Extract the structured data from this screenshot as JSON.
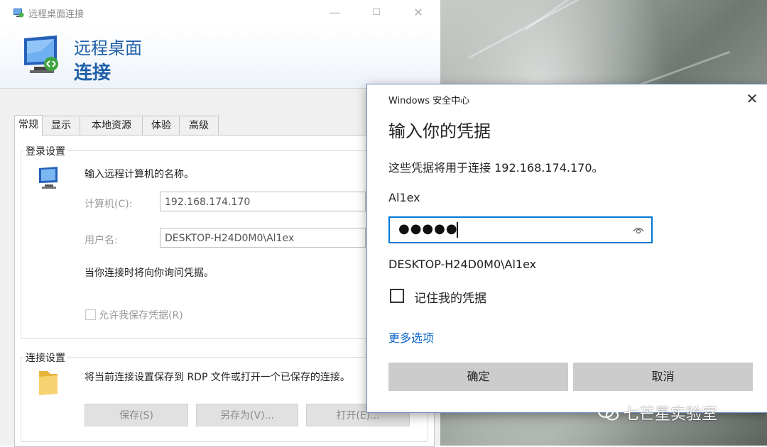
{
  "rdp": {
    "window_title": "远程桌面连接",
    "header_line1": "远程桌面",
    "header_line2": "连接",
    "minimize": "—",
    "maximize": "☐",
    "close": "✕",
    "tabs": [
      {
        "label": "常规",
        "active": true
      },
      {
        "label": "显示",
        "active": false
      },
      {
        "label": "本地资源",
        "active": false
      },
      {
        "label": "体验",
        "active": false
      },
      {
        "label": "高级",
        "active": false
      }
    ],
    "login": {
      "group_title": "登录设置",
      "instruction": "输入远程计算机的名称。",
      "computer_label": "计算机(C):",
      "computer_value": "192.168.174.170",
      "username_label": "用户名:",
      "username_value": "DESKTOP-H24D0M0\\Al1ex",
      "prompt_note": "当你连接时将向你询问凭据。",
      "allow_save_label": "允许我保存凭据(R)"
    },
    "connection": {
      "group_title": "连接设置",
      "description": "将当前连接设置保存到 RDP 文件或打开一个已保存的连接。",
      "save_button": "保存(S)",
      "save_as_button": "另存为(V)...",
      "open_button": "打开(E)..."
    }
  },
  "security": {
    "title": "Windows 安全中心",
    "close": "✕",
    "heading": "输入你的凭据",
    "description": "这些凭据将用于连接 192.168.174.170。",
    "username": "Al1ex",
    "password_mask": "●●●●●",
    "domain_user": "DESKTOP-H24D0M0\\Al1ex",
    "remember_label": "记住我的凭据",
    "remember_checked": false,
    "more_options": "更多选项",
    "ok_button": "确定",
    "cancel_button": "取消"
  },
  "watermark": {
    "text": "七芒星实验室",
    "icon": "wechat-icon"
  },
  "colors": {
    "accent_blue": "#1f5fa8",
    "focus_border": "#0078d7",
    "link": "#0a64c8",
    "button_gray": "#cccccc"
  }
}
